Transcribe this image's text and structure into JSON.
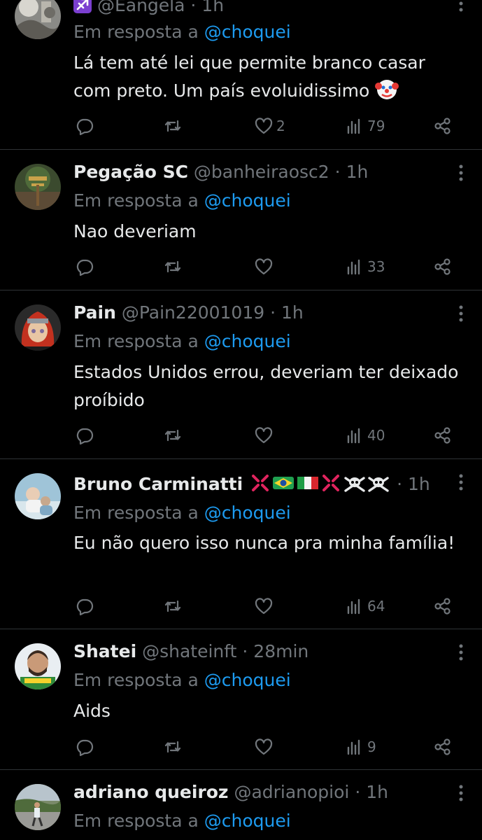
{
  "reply_prefix": "Em resposta a",
  "tweets": [
    {
      "name": "",
      "zodiac_badge": "♐",
      "handle": "@Eangela",
      "time": "1h",
      "reply_to": "@choquei",
      "text": "Lá tem até lei que permite branco casar com preto. Um país evoluidissimo",
      "emoji": "clown-face",
      "likes": "2",
      "views": "79"
    },
    {
      "name": "Pegação SC",
      "handle": "@banheiraosc2",
      "time": "1h",
      "reply_to": "@choquei",
      "text": "Nao deveriam",
      "likes": "",
      "views": "33"
    },
    {
      "name": "Pain",
      "handle": "@Pain22001019",
      "time": "1h",
      "reply_to": "@choquei",
      "text": "Estados Unidos errou, deveriam ter deixado proíbido",
      "likes": "",
      "views": "40"
    },
    {
      "name": "Bruno Carminatti",
      "name_emojis": [
        "anger-symbol",
        "brazil-flag",
        "italy-flag",
        "anger-symbol",
        "skull-and-crossbones",
        "skull-and-crossbones"
      ],
      "handle": "",
      "time": "1h",
      "reply_to": "@choquei",
      "text": "Eu não quero isso nunca pra minha família!",
      "likes": "",
      "views": "64"
    },
    {
      "name": "Shatei",
      "handle": "@shateinft",
      "time": "28min",
      "reply_to": "@choquei",
      "text": "Aids",
      "likes": "",
      "views": "9"
    },
    {
      "name": "adriano queiroz",
      "handle": "@adrianopioi",
      "time": "1h",
      "reply_to": "@choquei",
      "text": ""
    }
  ],
  "icons": {
    "reply": "speech-bubble-icon",
    "retweet": "retweet-icon",
    "like": "heart-icon",
    "views": "bar-chart-icon",
    "share": "share-icon",
    "more": "vertical-ellipsis-icon"
  },
  "colors": {
    "background": "#000000",
    "text": "#e7e9ea",
    "muted": "#71767b",
    "mention": "#1d9bf0",
    "divider": "#2f3336"
  }
}
